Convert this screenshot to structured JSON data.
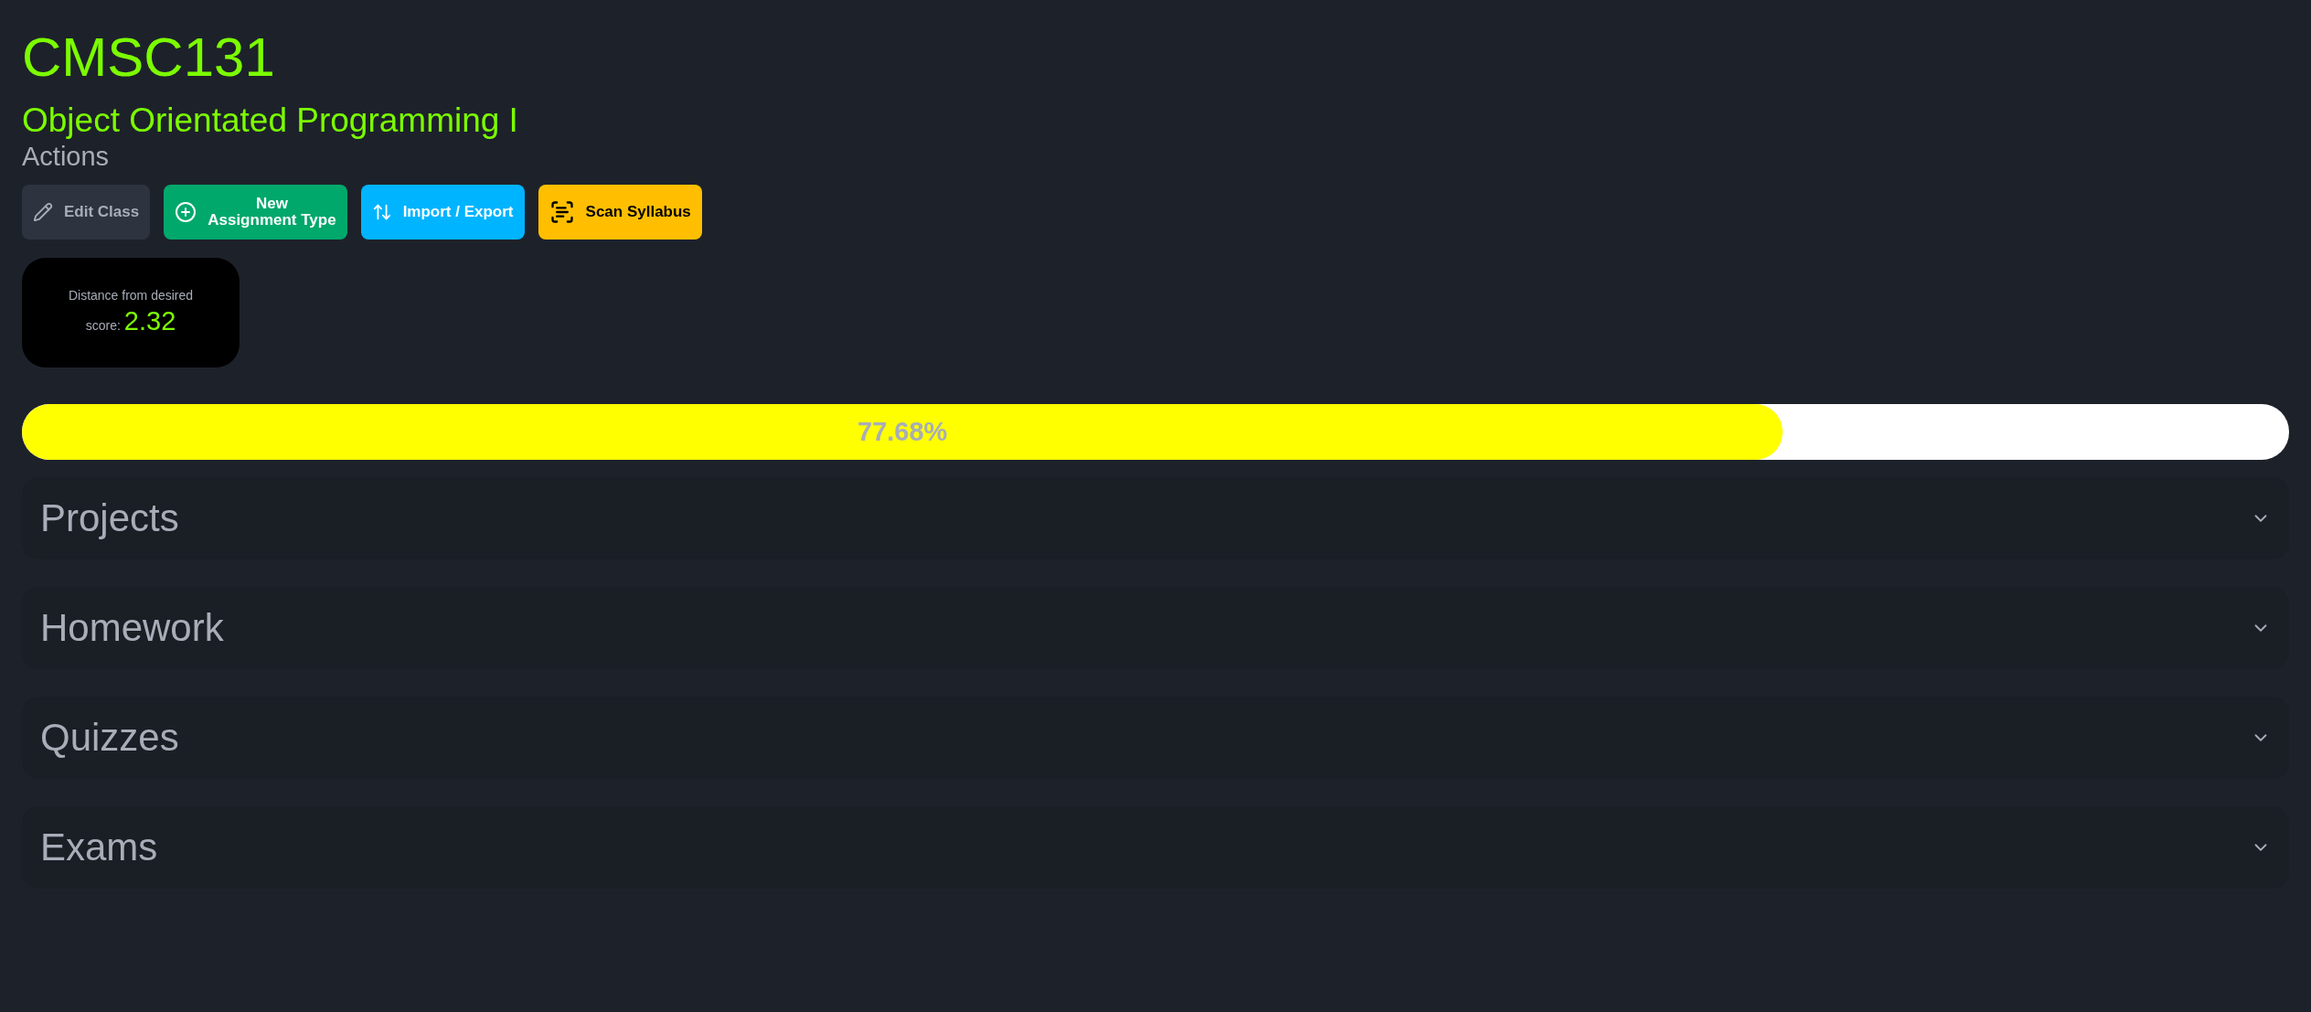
{
  "course": {
    "code": "CMSC131",
    "name": "Object Orientated Programming I"
  },
  "actions_label": "Actions",
  "actions": [
    {
      "kind": "edit",
      "label": "Edit Class"
    },
    {
      "kind": "new",
      "label": "New\nAssignment Type"
    },
    {
      "kind": "import",
      "label": "Import / Export"
    },
    {
      "kind": "scan",
      "label": "Scan Syllabus"
    }
  ],
  "score_card": {
    "label": "Distance from desired",
    "prefix": "score:",
    "value": "2.32"
  },
  "progress": {
    "level": 0.7768,
    "reading": "77.68%"
  },
  "sections": [
    {
      "title": "Projects",
      "expanded": false
    },
    {
      "title": "Homework",
      "expanded": false
    },
    {
      "title": "Quizzes",
      "expanded": false
    },
    {
      "title": "Exams",
      "expanded": false
    }
  ]
}
